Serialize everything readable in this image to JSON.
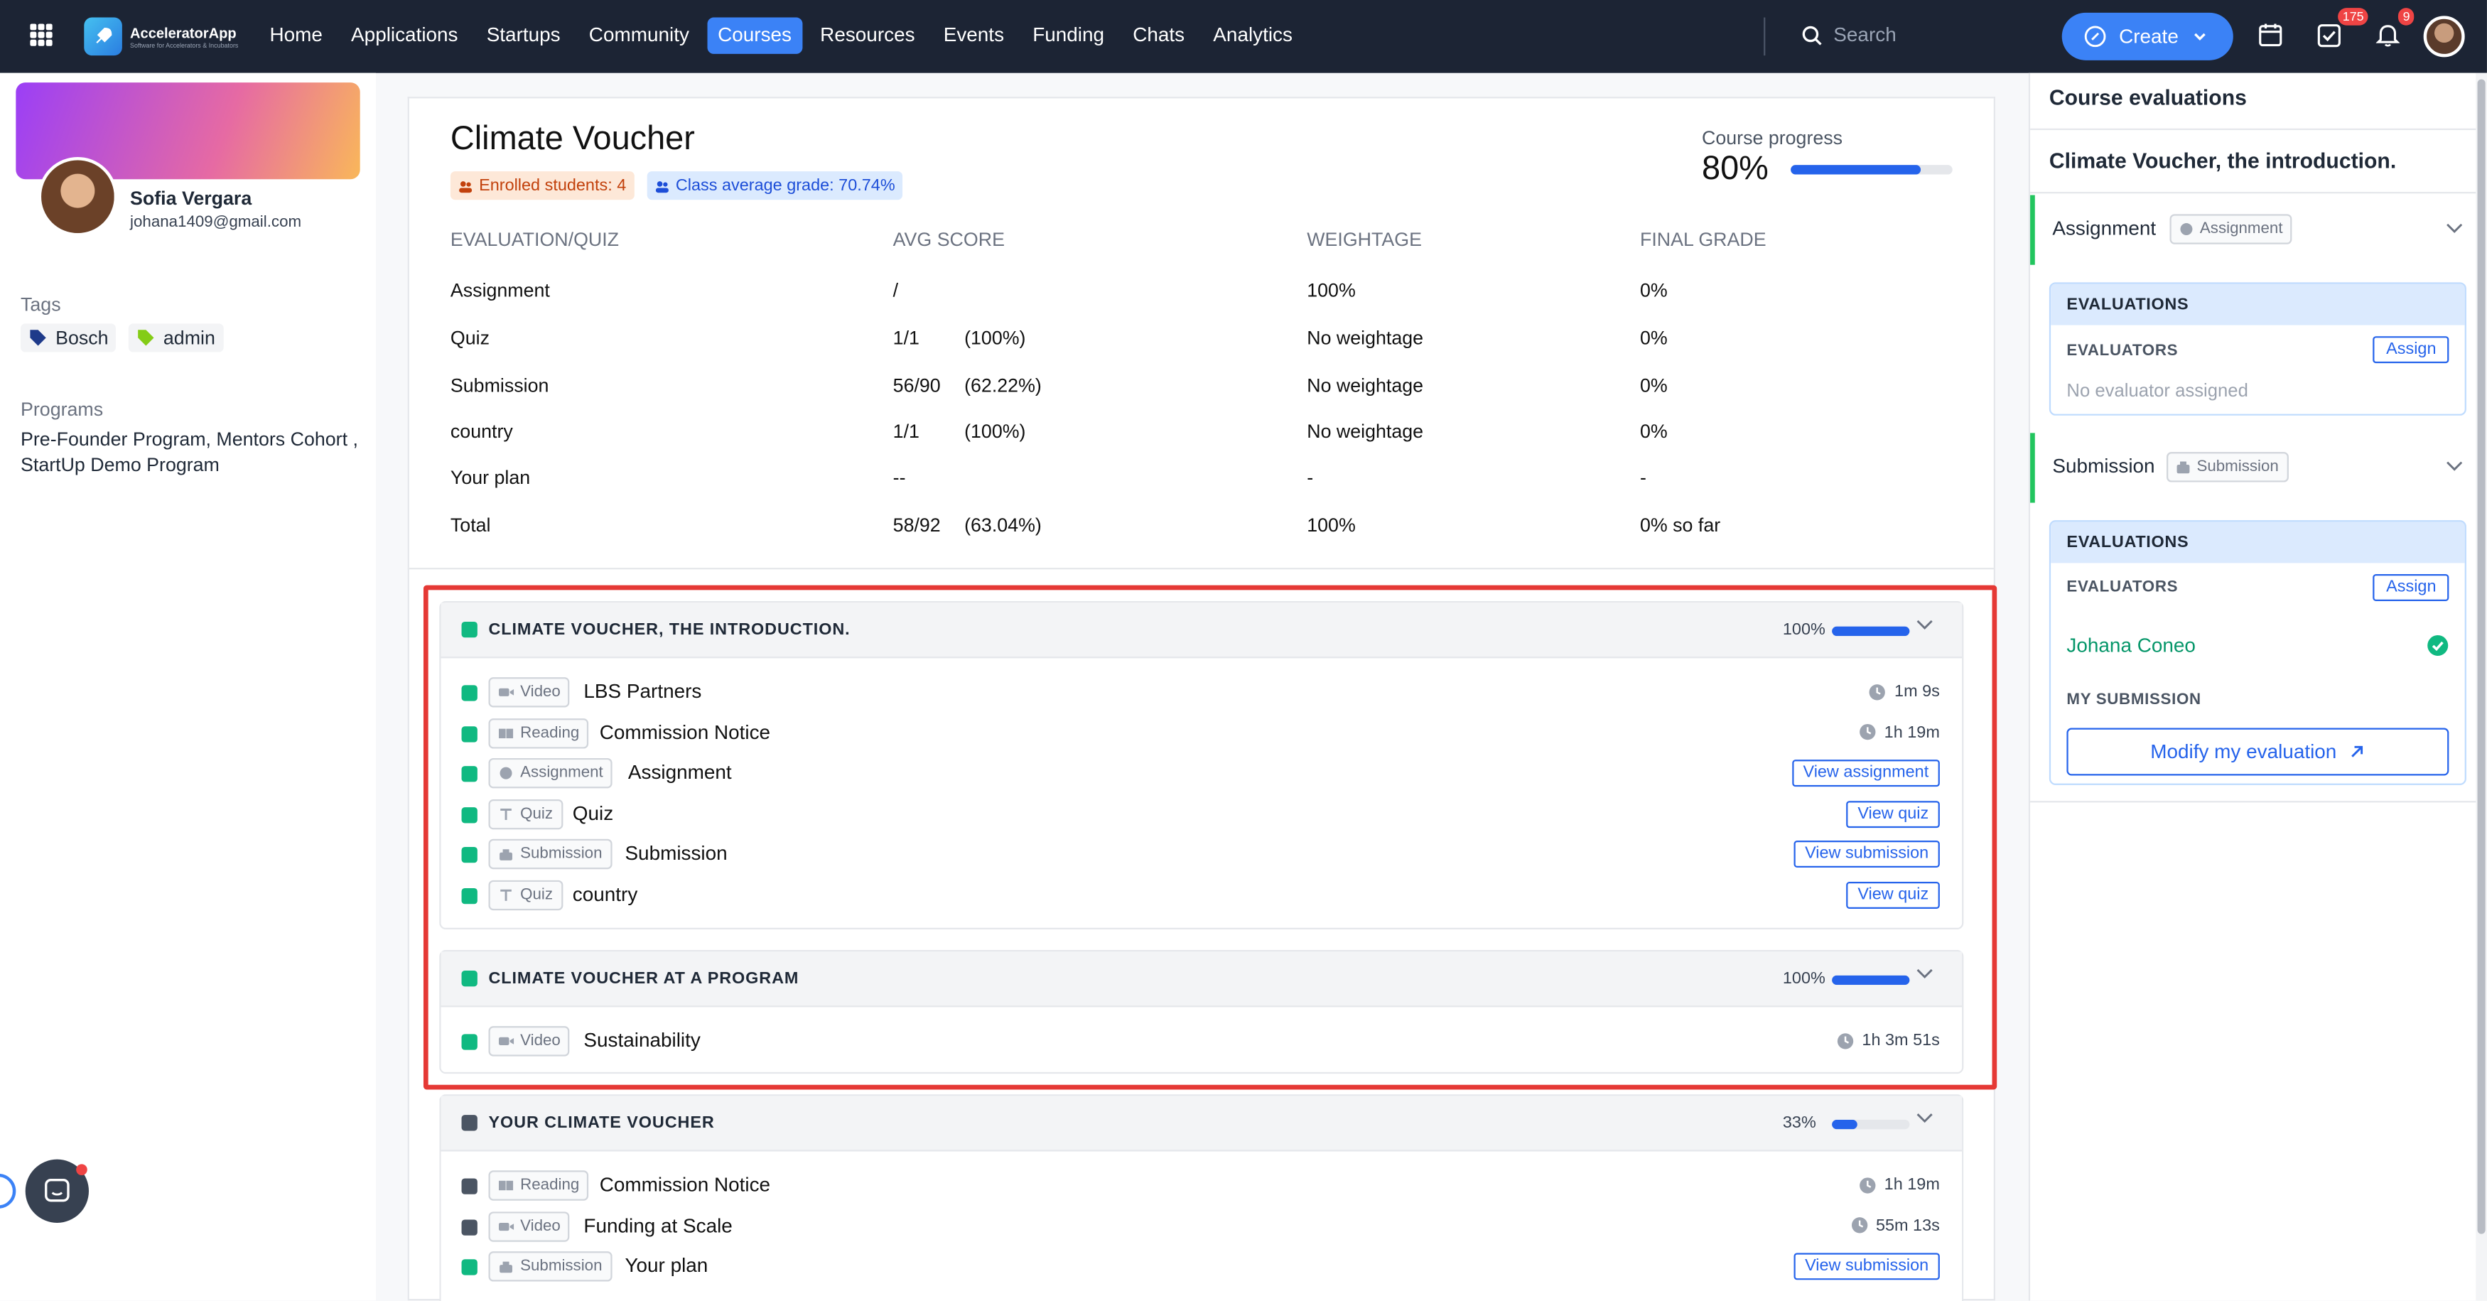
{
  "app": {
    "name": "AcceleratorApp",
    "tagline": "Software for Accelerators & Incubators"
  },
  "nav": {
    "items": [
      "Home",
      "Applications",
      "Startups",
      "Community",
      "Courses",
      "Resources",
      "Events",
      "Funding",
      "Chats",
      "Analytics"
    ],
    "active": "Courses"
  },
  "search": {
    "placeholder": "Search"
  },
  "create": {
    "label": "Create"
  },
  "badges": {
    "tasks": "175",
    "notifications": "9"
  },
  "profile": {
    "name": "Sofia Vergara",
    "email": "johana1409@gmail.com"
  },
  "tags": {
    "label": "Tags",
    "items": [
      {
        "name": "Bosch",
        "color": "#1e3a8a"
      },
      {
        "name": "admin",
        "color": "#84cc16"
      }
    ]
  },
  "programs": {
    "label": "Programs",
    "text": "Pre-Founder Program, Mentors Cohort , StartUp Demo Program"
  },
  "course": {
    "title": "Climate Voucher",
    "enrolled": "Enrolled students: 4",
    "class_avg": "Class average grade: 70.74%",
    "progress_label": "Course progress",
    "progress_value": "80%",
    "progress_fraction": 0.8
  },
  "table": {
    "headers": [
      "EVALUATION/QUIZ",
      "AVG SCORE",
      "WEIGHTAGE",
      "FINAL GRADE"
    ],
    "rows": [
      {
        "name": "Assignment",
        "score": "/",
        "pct": "",
        "weight": "100%",
        "grade": "0%"
      },
      {
        "name": "Quiz",
        "score": "1/1",
        "pct": "(100%)",
        "weight": "No weightage",
        "grade": "0%"
      },
      {
        "name": "Submission",
        "score": "56/90",
        "pct": "(62.22%)",
        "weight": "No weightage",
        "grade": "0%"
      },
      {
        "name": "country",
        "score": "1/1",
        "pct": "(100%)",
        "weight": "No weightage",
        "grade": "0%"
      },
      {
        "name": "Your plan",
        "score": "--",
        "pct": "",
        "weight": "-",
        "grade": "-"
      },
      {
        "name": "Total",
        "score": "58/92",
        "pct": "(63.04%)",
        "weight": "100%",
        "grade": "0% so far"
      }
    ]
  },
  "sections": [
    {
      "title": "CLIMATE VOUCHER, THE INTRODUCTION.",
      "pct": "100%",
      "fraction": 1.0,
      "color": "#10b981",
      "items": [
        {
          "type": "Video",
          "icon": "video-icon",
          "name": "LBS Partners",
          "duration": "1m 9s"
        },
        {
          "type": "Reading",
          "icon": "book-icon",
          "name": "Commission Notice",
          "duration": "1h 19m"
        },
        {
          "type": "Assignment",
          "icon": "assignment-icon",
          "name": "Assignment",
          "action": "View assignment"
        },
        {
          "type": "Quiz",
          "icon": "quiz-icon",
          "name": "Quiz",
          "action": "View quiz"
        },
        {
          "type": "Submission",
          "icon": "submission-icon",
          "name": "Submission",
          "action": "View submission"
        },
        {
          "type": "Quiz",
          "icon": "quiz-icon",
          "name": "country",
          "action": "View quiz"
        }
      ]
    },
    {
      "title": "CLIMATE VOUCHER AT A PROGRAM",
      "pct": "100%",
      "fraction": 1.0,
      "color": "#10b981",
      "items": [
        {
          "type": "Video",
          "icon": "video-icon",
          "name": "Sustainability",
          "duration": "1h 3m 51s"
        }
      ]
    },
    {
      "title": "YOUR CLIMATE VOUCHER",
      "pct": "33%",
      "fraction": 0.33,
      "color": "#4b5563",
      "items": [
        {
          "type": "Reading",
          "icon": "book-icon",
          "name": "Commission Notice",
          "duration": "1h 19m",
          "color": "#4b5563"
        },
        {
          "type": "Video",
          "icon": "video-icon",
          "name": "Funding at Scale",
          "duration": "55m 13s",
          "color": "#4b5563"
        },
        {
          "type": "Submission",
          "icon": "submission-icon",
          "name": "Your plan",
          "action": "View submission",
          "color": "#10b981"
        }
      ]
    }
  ],
  "right_panel": {
    "title": "Course evaluations",
    "subtitle": "Climate Voucher, the introduction.",
    "assignment": {
      "label": "Assignment",
      "pill": "Assignment"
    },
    "submission": {
      "label": "Submission",
      "pill": "Submission"
    },
    "eval_header": "EVALUATIONS",
    "evaluators_label": "EVALUATORS",
    "assign_label": "Assign",
    "no_evaluator": "No evaluator assigned",
    "evaluator_name": "Johana Coneo",
    "my_submission": "MY SUBMISSION",
    "modify_label": "Modify my evaluation"
  }
}
